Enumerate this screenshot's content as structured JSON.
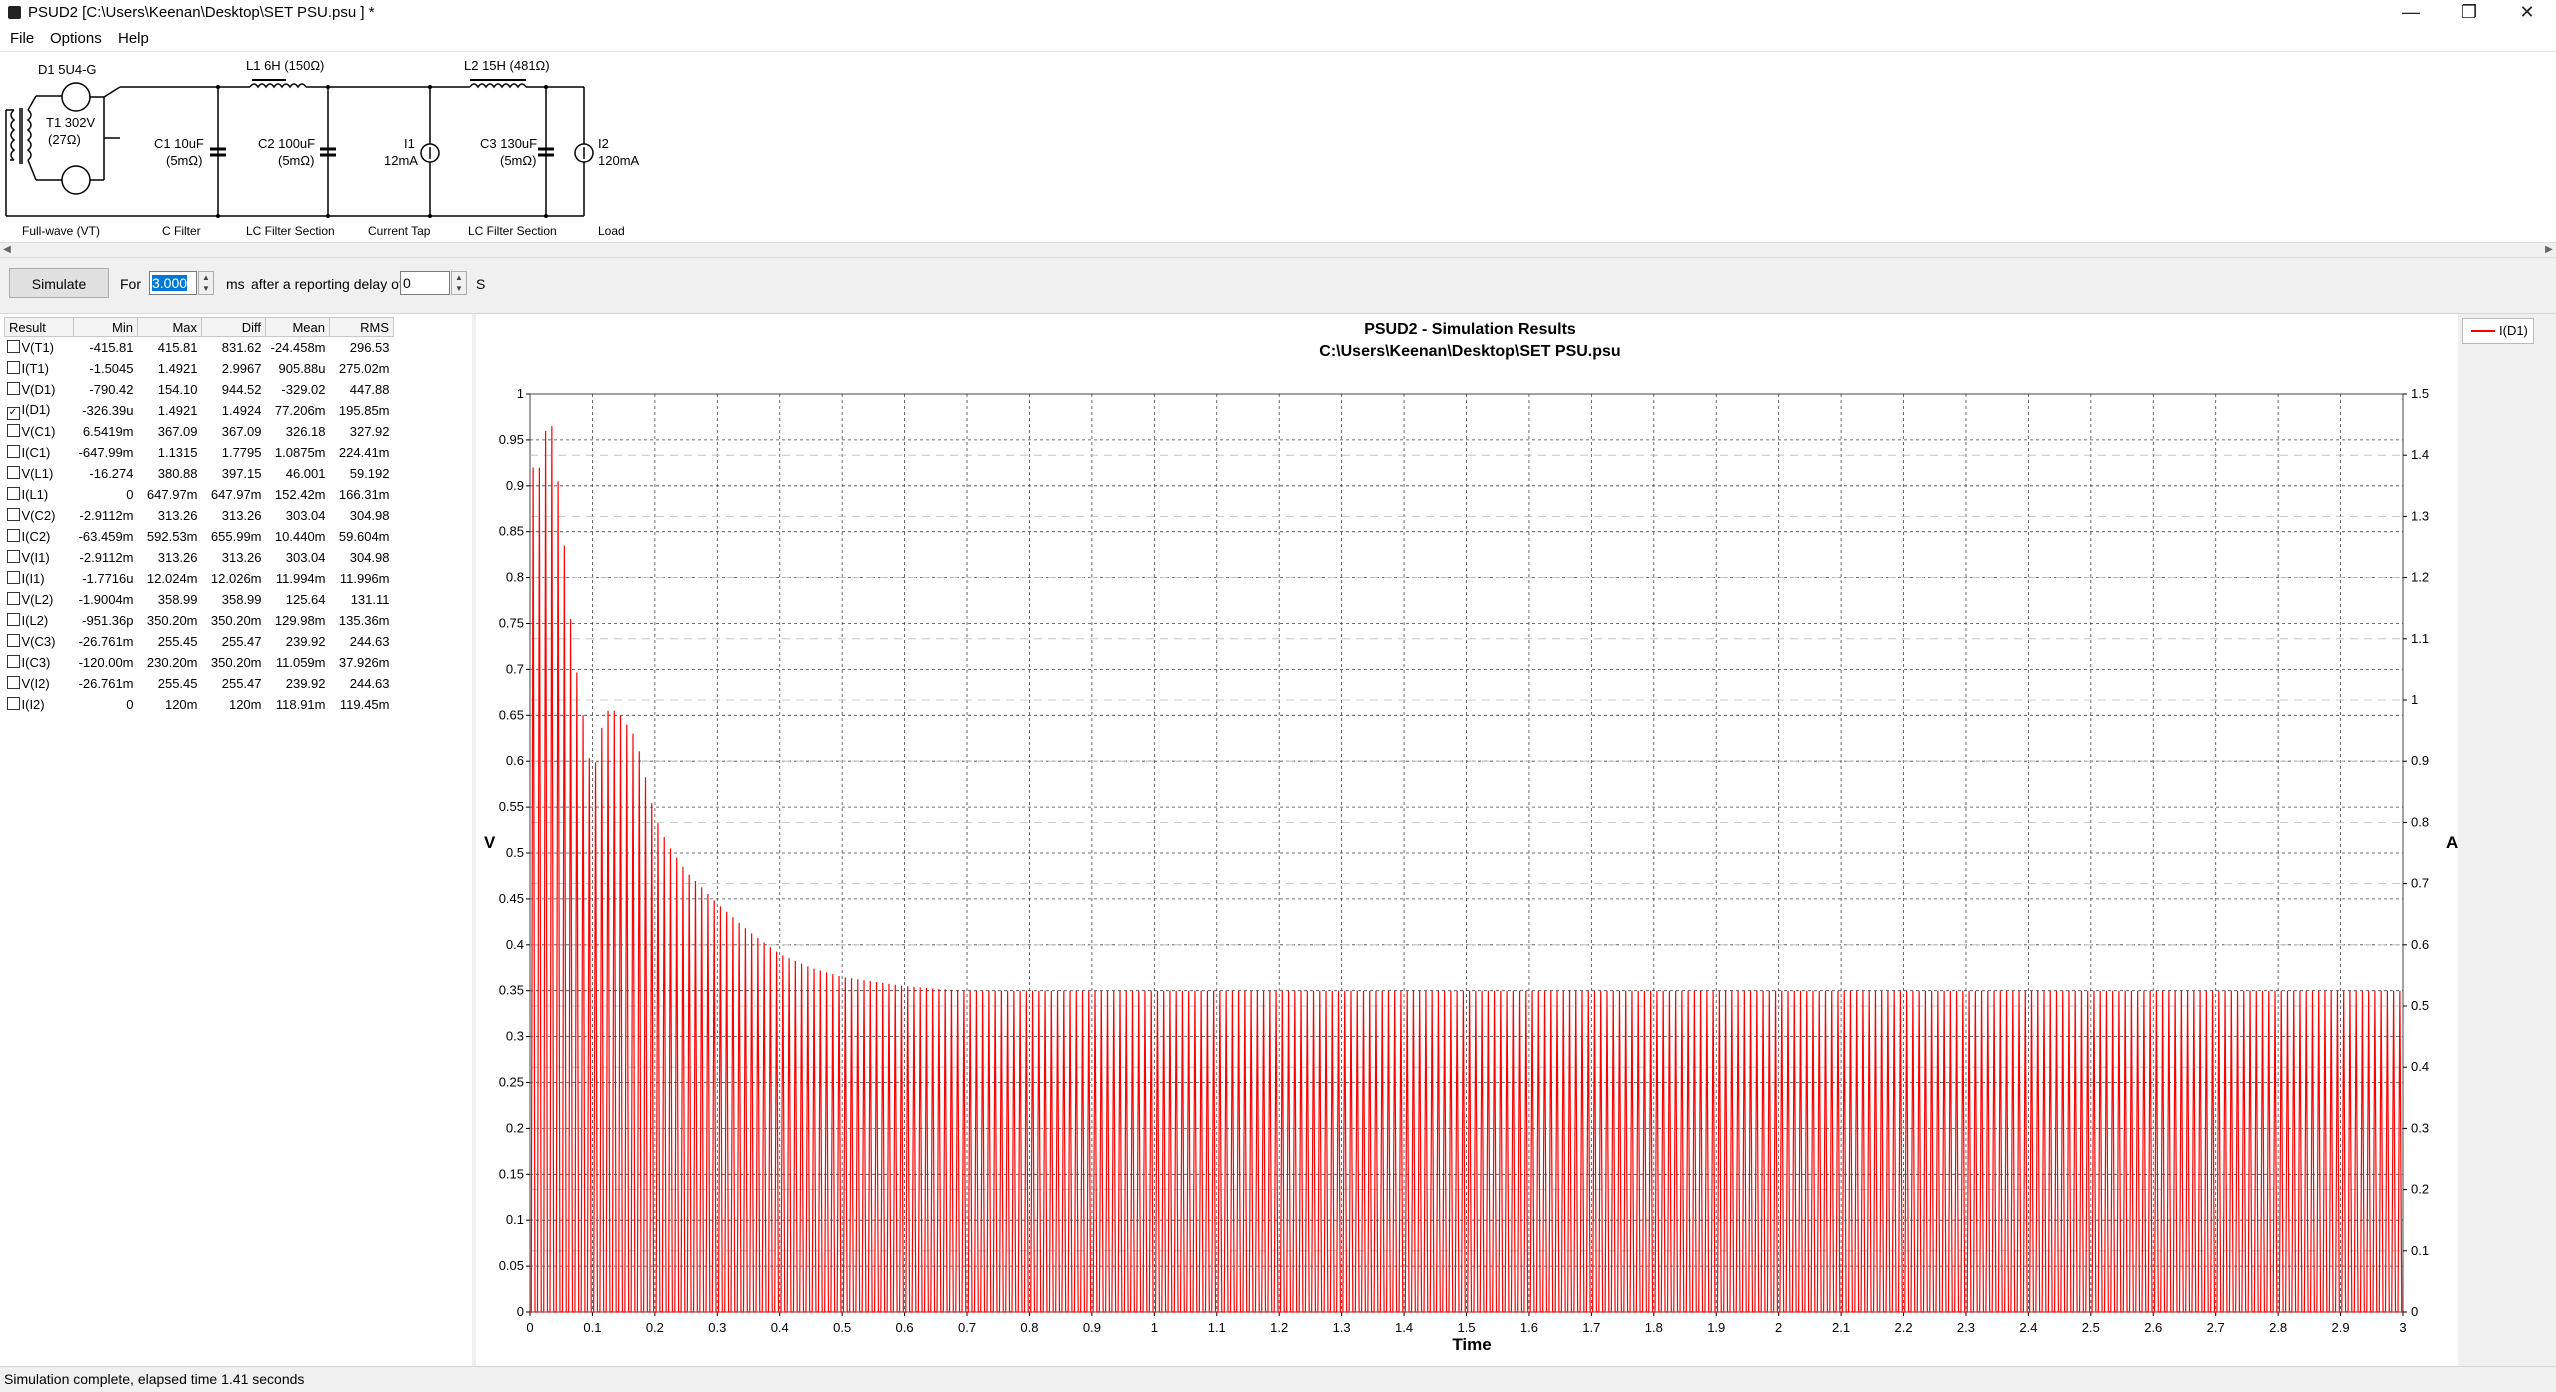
{
  "window": {
    "title": "PSUD2  [C:\\Users\\Keenan\\Desktop\\SET PSU.psu ] *",
    "minimize": "—",
    "maximize": "❐",
    "close": "✕"
  },
  "menu": [
    "File",
    "Options",
    "Help"
  ],
  "schematic": {
    "components": {
      "d1": "D1 5U4-G",
      "t1_a": "T1 302V",
      "t1_b": "(27Ω)",
      "l1": "L1 6H (150Ω)",
      "l2": "L2 15H (481Ω)",
      "c1_a": "C1 10uF",
      "c1_b": "(5mΩ)",
      "c2_a": "C2 100uF",
      "c2_b": "(5mΩ)",
      "i1_a": "I1",
      "i1_b": "12mA",
      "c3_a": "C3 130uF",
      "c3_b": "(5mΩ)",
      "i2_a": "I2",
      "i2_b": "120mA"
    },
    "sections": [
      "Full-wave (VT)",
      "C Filter",
      "LC Filter Section",
      "Current Tap",
      "LC Filter Section",
      "Load"
    ]
  },
  "toolbar": {
    "simulate": "Simulate",
    "for_label": "For",
    "duration": "3.000",
    "ms_label": "ms",
    "delay_label": "after a reporting delay of",
    "delay": "0",
    "s_label": "S"
  },
  "results": {
    "headers": [
      "Result",
      "Min",
      "Max",
      "Diff",
      "Mean",
      "RMS"
    ],
    "rows": [
      {
        "name": "V(T1)",
        "checked": false,
        "min": "-415.81",
        "max": "415.81",
        "diff": "831.62",
        "mean": "-24.458m",
        "rms": "296.53"
      },
      {
        "name": "I(T1)",
        "checked": false,
        "min": "-1.5045",
        "max": "1.4921",
        "diff": "2.9967",
        "mean": "905.88u",
        "rms": "275.02m"
      },
      {
        "name": "V(D1)",
        "checked": false,
        "min": "-790.42",
        "max": "154.10",
        "diff": "944.52",
        "mean": "-329.02",
        "rms": "447.88"
      },
      {
        "name": "I(D1)",
        "checked": true,
        "min": "-326.39u",
        "max": "1.4921",
        "diff": "1.4924",
        "mean": "77.206m",
        "rms": "195.85m"
      },
      {
        "name": "V(C1)",
        "checked": false,
        "min": "6.5419m",
        "max": "367.09",
        "diff": "367.09",
        "mean": "326.18",
        "rms": "327.92"
      },
      {
        "name": "I(C1)",
        "checked": false,
        "min": "-647.99m",
        "max": "1.1315",
        "diff": "1.7795",
        "mean": "1.0875m",
        "rms": "224.41m"
      },
      {
        "name": "V(L1)",
        "checked": false,
        "min": "-16.274",
        "max": "380.88",
        "diff": "397.15",
        "mean": "46.001",
        "rms": "59.192"
      },
      {
        "name": "I(L1)",
        "checked": false,
        "min": "0",
        "max": "647.97m",
        "diff": "647.97m",
        "mean": "152.42m",
        "rms": "166.31m"
      },
      {
        "name": "V(C2)",
        "checked": false,
        "min": "-2.9112m",
        "max": "313.26",
        "diff": "313.26",
        "mean": "303.04",
        "rms": "304.98"
      },
      {
        "name": "I(C2)",
        "checked": false,
        "min": "-63.459m",
        "max": "592.53m",
        "diff": "655.99m",
        "mean": "10.440m",
        "rms": "59.604m"
      },
      {
        "name": "V(I1)",
        "checked": false,
        "min": "-2.9112m",
        "max": "313.26",
        "diff": "313.26",
        "mean": "303.04",
        "rms": "304.98"
      },
      {
        "name": "I(I1)",
        "checked": false,
        "min": "-1.7716u",
        "max": "12.024m",
        "diff": "12.026m",
        "mean": "11.994m",
        "rms": "11.996m"
      },
      {
        "name": "V(L2)",
        "checked": false,
        "min": "-1.9004m",
        "max": "358.99",
        "diff": "358.99",
        "mean": "125.64",
        "rms": "131.11"
      },
      {
        "name": "I(L2)",
        "checked": false,
        "min": "-951.36p",
        "max": "350.20m",
        "diff": "350.20m",
        "mean": "129.98m",
        "rms": "135.36m"
      },
      {
        "name": "V(C3)",
        "checked": false,
        "min": "-26.761m",
        "max": "255.45",
        "diff": "255.47",
        "mean": "239.92",
        "rms": "244.63"
      },
      {
        "name": "I(C3)",
        "checked": false,
        "min": "-120.00m",
        "max": "230.20m",
        "diff": "350.20m",
        "mean": "11.059m",
        "rms": "37.926m"
      },
      {
        "name": "V(I2)",
        "checked": false,
        "min": "-26.761m",
        "max": "255.45",
        "diff": "255.47",
        "mean": "239.92",
        "rms": "244.63"
      },
      {
        "name": "I(I2)",
        "checked": false,
        "min": "0",
        "max": "120m",
        "diff": "120m",
        "mean": "118.91m",
        "rms": "119.45m"
      }
    ]
  },
  "chart_data": {
    "type": "line",
    "title": "PSUD2 - Simulation Results",
    "subtitle": "C:\\Users\\Keenan\\Desktop\\SET PSU.psu",
    "xlabel": "Time",
    "ylabel": "V",
    "y2label": "A",
    "xlim": [
      0,
      3
    ],
    "ylim": [
      0,
      1
    ],
    "y2lim": [
      0,
      1.5
    ],
    "x_ticks": [
      "0",
      "0.1",
      "0.2",
      "0.3",
      "0.4",
      "0.5",
      "0.6",
      "0.7",
      "0.8",
      "0.9",
      "1",
      "1.1",
      "1.2",
      "1.3",
      "1.4",
      "1.5",
      "1.6",
      "1.7",
      "1.8",
      "1.9",
      "2",
      "2.1",
      "2.2",
      "2.3",
      "2.4",
      "2.5",
      "2.6",
      "2.7",
      "2.8",
      "2.9",
      "3"
    ],
    "y_ticks": [
      "0",
      "0.05",
      "0.1",
      "0.15",
      "0.2",
      "0.25",
      "0.3",
      "0.35",
      "0.4",
      "0.45",
      "0.5",
      "0.55",
      "0.6",
      "0.65",
      "0.7",
      "0.75",
      "0.8",
      "0.85",
      "0.9",
      "0.95",
      "1"
    ],
    "y2_ticks": [
      "0",
      "0.1",
      "0.2",
      "0.3",
      "0.4",
      "0.5",
      "0.6",
      "0.7",
      "0.8",
      "0.9",
      "1",
      "1.1",
      "1.2",
      "1.3",
      "1.4",
      "1.5"
    ],
    "grid": true,
    "legend_position": "top-right",
    "series": [
      {
        "name": "I(D1)",
        "color": "#ff0000",
        "pulse_period": 0.01,
        "peaks": [
          [
            0.02,
            0.92
          ],
          [
            0.03,
            1.0
          ],
          [
            0.04,
            0.93
          ],
          [
            0.05,
            0.88
          ],
          [
            0.06,
            0.79
          ],
          [
            0.07,
            0.72
          ],
          [
            0.1,
            0.58
          ],
          [
            0.12,
            0.655
          ],
          [
            0.14,
            0.655
          ],
          [
            0.17,
            0.625
          ],
          [
            0.2,
            0.54
          ],
          [
            0.22,
            0.51
          ],
          [
            0.25,
            0.48
          ],
          [
            0.3,
            0.445
          ],
          [
            0.35,
            0.415
          ],
          [
            0.4,
            0.39
          ],
          [
            0.45,
            0.375
          ],
          [
            0.5,
            0.365
          ],
          [
            0.55,
            0.36
          ],
          [
            0.6,
            0.355
          ],
          [
            0.65,
            0.352
          ],
          [
            0.7,
            0.35
          ],
          [
            3.0,
            0.35
          ]
        ]
      }
    ]
  },
  "legend": {
    "label": "I(D1)"
  },
  "status": "Simulation complete, elapsed time 1.41 seconds"
}
